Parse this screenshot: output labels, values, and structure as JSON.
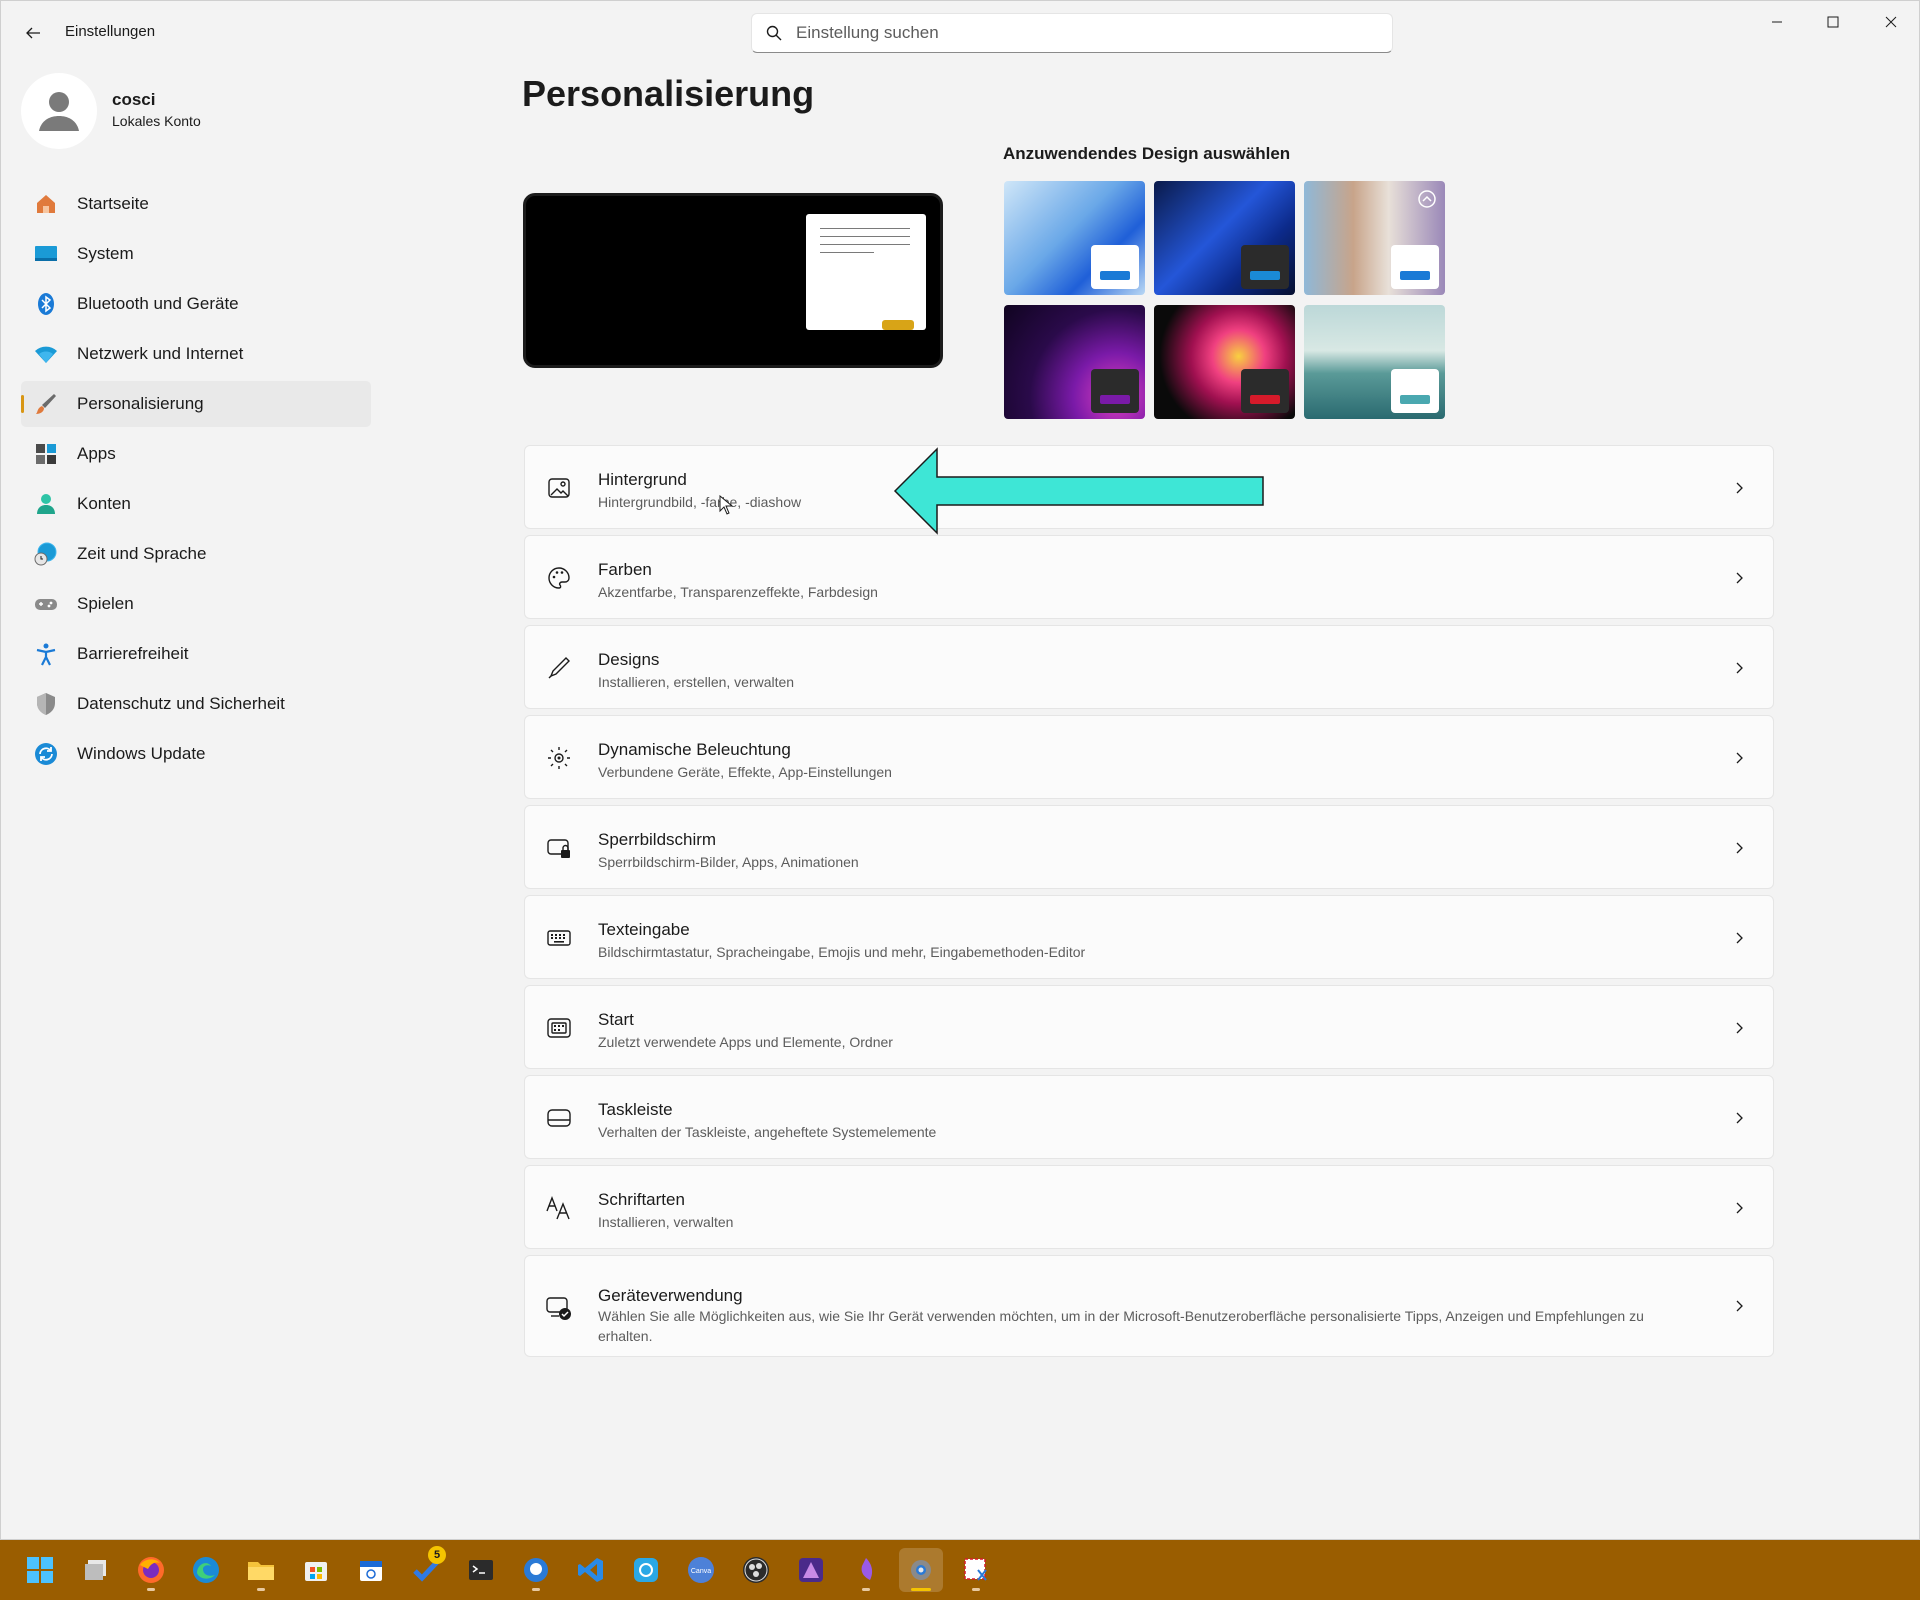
{
  "app": {
    "title": "Einstellungen"
  },
  "search": {
    "placeholder": "Einstellung suchen"
  },
  "profile": {
    "name": "cosci",
    "account_type": "Lokales Konto"
  },
  "nav": {
    "items": [
      {
        "label": "Startseite",
        "icon": "home-icon"
      },
      {
        "label": "System",
        "icon": "monitor-icon"
      },
      {
        "label": "Bluetooth und Geräte",
        "icon": "bluetooth-icon"
      },
      {
        "label": "Netzwerk und Internet",
        "icon": "wifi-icon"
      },
      {
        "label": "Personalisierung",
        "icon": "brush-icon",
        "active": true
      },
      {
        "label": "Apps",
        "icon": "apps-icon"
      },
      {
        "label": "Konten",
        "icon": "person-icon"
      },
      {
        "label": "Zeit und Sprache",
        "icon": "globe-clock-icon"
      },
      {
        "label": "Spielen",
        "icon": "gamepad-icon"
      },
      {
        "label": "Barrierefreiheit",
        "icon": "accessibility-icon"
      },
      {
        "label": "Datenschutz und Sicherheit",
        "icon": "shield-icon"
      },
      {
        "label": "Windows Update",
        "icon": "update-icon"
      }
    ]
  },
  "main": {
    "title": "Personalisierung",
    "design_section_title": "Anzuwendendes Design auswählen",
    "cards": [
      {
        "title": "Hintergrund",
        "subtitle": "Hintergrundbild, -farbe, -diashow",
        "icon": "image-icon"
      },
      {
        "title": "Farben",
        "subtitle": "Akzentfarbe, Transparenzeffekte, Farbdesign",
        "icon": "palette-icon"
      },
      {
        "title": "Designs",
        "subtitle": "Installieren, erstellen, verwalten",
        "icon": "pen-icon"
      },
      {
        "title": "Dynamische Beleuchtung",
        "subtitle": "Verbundene Geräte, Effekte, App-Einstellungen",
        "icon": "lighting-icon"
      },
      {
        "title": "Sperrbildschirm",
        "subtitle": "Sperrbildschirm-Bilder, Apps, Animationen",
        "icon": "lockscreen-icon"
      },
      {
        "title": "Texteingabe",
        "subtitle": "Bildschirmtastatur, Spracheingabe, Emojis und mehr, Eingabemethoden-Editor",
        "icon": "keyboard-icon"
      },
      {
        "title": "Start",
        "subtitle": "Zuletzt verwendete Apps und Elemente, Ordner",
        "icon": "start-icon"
      },
      {
        "title": "Taskleiste",
        "subtitle": "Verhalten der Taskleiste, angeheftete Systemelemente",
        "icon": "taskbar-icon"
      },
      {
        "title": "Schriftarten",
        "subtitle": "Installieren, verwalten",
        "icon": "font-icon"
      },
      {
        "title": "Geräteverwendung",
        "subtitle": "Wählen Sie alle Möglichkeiten aus, wie Sie Ihr Gerät verwenden möchten, um in der Microsoft-Benutzeroberfläche personalisierte Tipps, Anzeigen und Empfehlungen zu erhalten.",
        "icon": "device-usage-icon"
      }
    ]
  },
  "colors": {
    "accent": "#d89614",
    "taskbar": "#9a5d00",
    "annotation_arrow": "#3ee6d6"
  },
  "taskbar": {
    "badge_count": "5",
    "icons": [
      "start-icon",
      "task-view-icon",
      "firefox-icon",
      "edge-icon",
      "file-explorer-icon",
      "store-icon",
      "calendar-icon",
      "todo-icon",
      "terminal-icon",
      "chat-icon",
      "vscode-icon",
      "sync-icon",
      "canva-icon",
      "obs-icon",
      "affinity-icon",
      "purple-app-icon",
      "settings-icon",
      "snipping-tool-icon"
    ]
  }
}
